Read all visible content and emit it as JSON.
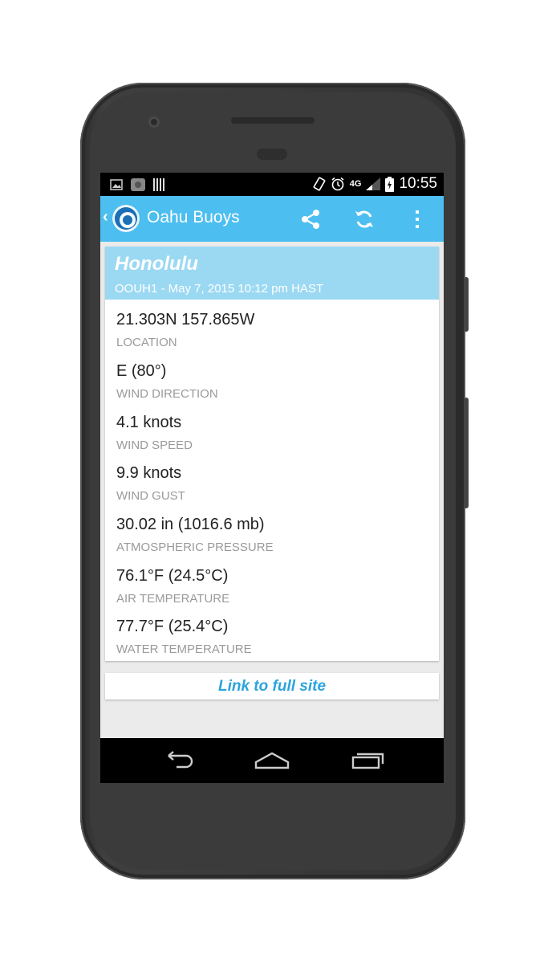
{
  "status_bar": {
    "left_icons": [
      "image-icon",
      "photo-icon",
      "barcode-icon"
    ],
    "right_icons": [
      "rotate-icon",
      "alarm-icon",
      "4g-signal-icon",
      "battery-icon"
    ],
    "network": "4G",
    "time": "10:55"
  },
  "app_bar": {
    "title": "Oahu Buoys",
    "actions": [
      "share-icon",
      "refresh-icon",
      "overflow-menu-icon"
    ]
  },
  "station": {
    "name": "Honolulu",
    "subtitle": "OOUH1 - May 7, 2015 10:12 pm HAST",
    "readings": [
      {
        "value": "21.303N 157.865W",
        "label": "LOCATION"
      },
      {
        "value": "E (80°)",
        "label": "WIND DIRECTION"
      },
      {
        "value": "4.1 knots",
        "label": "WIND SPEED"
      },
      {
        "value": "9.9 knots",
        "label": "WIND GUST"
      },
      {
        "value": "30.02 in (1016.6 mb)",
        "label": "ATMOSPHERIC PRESSURE"
      },
      {
        "value": "76.1°F (24.5°C)",
        "label": "AIR TEMPERATURE"
      },
      {
        "value": "77.7°F (25.4°C)",
        "label": "WATER TEMPERATURE"
      }
    ]
  },
  "footer_link": "Link to full site",
  "nav_bar": [
    "back-icon",
    "home-icon",
    "recents-icon"
  ],
  "colors": {
    "app_bar": "#4cbeef",
    "card_header": "#9bd9f3",
    "link": "#2aa4dc"
  }
}
